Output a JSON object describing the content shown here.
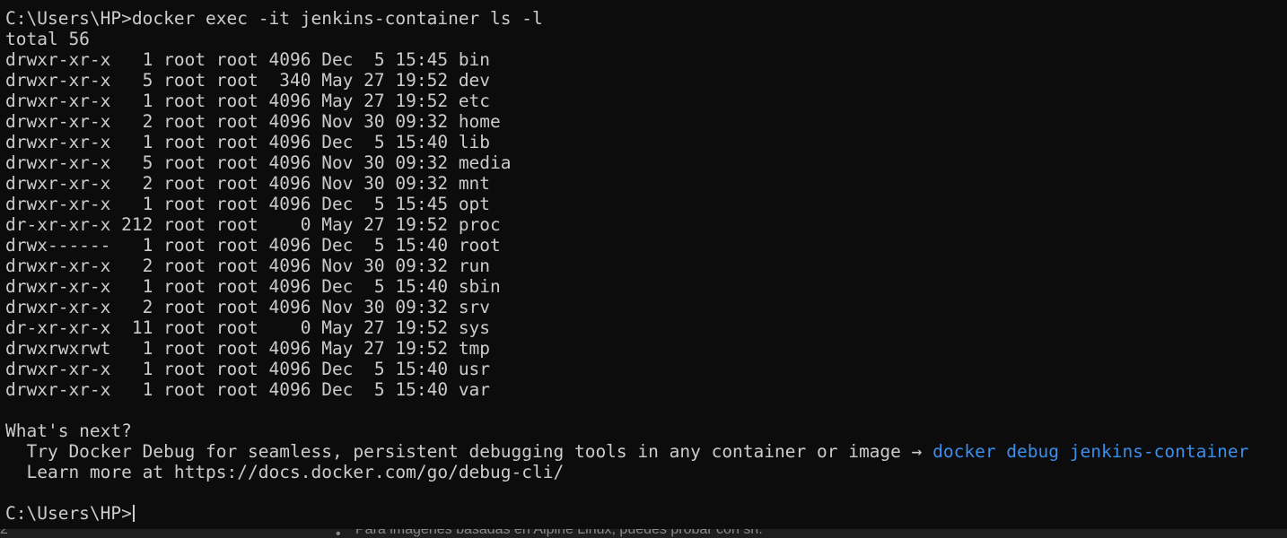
{
  "terminal": {
    "command_line": "C:\\Users\\HP>docker exec -it jenkins-container ls -l",
    "total": "total 56",
    "listing": [
      "drwxr-xr-x   1 root root 4096 Dec  5 15:45 bin",
      "drwxr-xr-x   5 root root  340 May 27 19:52 dev",
      "drwxr-xr-x   1 root root 4096 May 27 19:52 etc",
      "drwxr-xr-x   2 root root 4096 Nov 30 09:32 home",
      "drwxr-xr-x   1 root root 4096 Dec  5 15:40 lib",
      "drwxr-xr-x   5 root root 4096 Nov 30 09:32 media",
      "drwxr-xr-x   2 root root 4096 Nov 30 09:32 mnt",
      "drwxr-xr-x   1 root root 4096 Dec  5 15:45 opt",
      "dr-xr-xr-x 212 root root    0 May 27 19:52 proc",
      "drwx------   1 root root 4096 Dec  5 15:40 root",
      "drwxr-xr-x   2 root root 4096 Nov 30 09:32 run",
      "drwxr-xr-x   1 root root 4096 Dec  5 15:40 sbin",
      "drwxr-xr-x   2 root root 4096 Nov 30 09:32 srv",
      "dr-xr-xr-x  11 root root    0 May 27 19:52 sys",
      "drwxrwxrwt   1 root root 4096 May 27 19:52 tmp",
      "drwxr-xr-x   1 root root 4096 Dec  5 15:40 usr",
      "drwxr-xr-x   1 root root 4096 Dec  5 15:40 var"
    ],
    "whats_next_heading": "What's next?",
    "try_text": "  Try Docker Debug for seamless, persistent debugging tools in any container or image → ",
    "try_command": "docker debug jenkins-container",
    "learn_more": "  Learn more at https://docs.docker.com/go/debug-cli/",
    "prompt": "C:\\Users\\HP>"
  },
  "background_page": {
    "edge_text": "2",
    "bullet": "•",
    "text": "Para imágenes basadas en Alpine Linux, puedes probar con sh."
  },
  "colors": {
    "background": "#0c0c0c",
    "foreground": "#cccccc",
    "link": "#3b8eea"
  }
}
